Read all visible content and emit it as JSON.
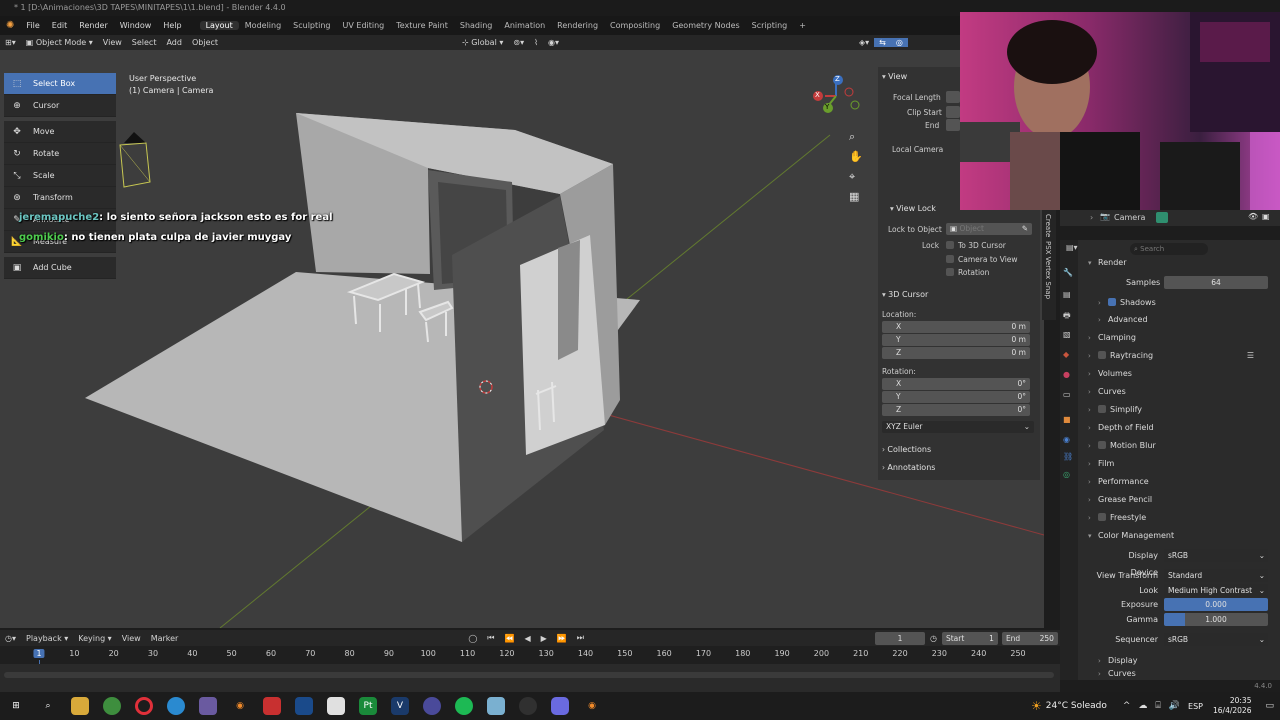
{
  "window": {
    "title": "* 1 [D:\\Animaciones\\3D TAPES\\MINITAPES\\1\\1.blend] - Blender 4.4.0"
  },
  "menubar": {
    "menus": [
      "File",
      "Edit",
      "Render",
      "Window",
      "Help"
    ],
    "workspaces": [
      "Layout",
      "Modeling",
      "Sculpting",
      "UV Editing",
      "Texture Paint",
      "Shading",
      "Animation",
      "Rendering",
      "Compositing",
      "Geometry Nodes",
      "Scripting"
    ],
    "active_workspace": "Layout",
    "add_tab": "+"
  },
  "viewport_header": {
    "mode": "Object Mode",
    "menus": [
      "View",
      "Select",
      "Add",
      "Object"
    ],
    "orientation": "Global"
  },
  "toolbar": {
    "tools": [
      "Select Box",
      "Cursor",
      "Move",
      "Rotate",
      "Scale",
      "Transform",
      "Annotate",
      "Measure",
      "Add Cube"
    ],
    "active": "Select Box"
  },
  "overlay": {
    "line1": "User Perspective",
    "line2": "(1) Camera | Camera"
  },
  "chat": [
    {
      "user": "jeremapuche2",
      "message": "lo siento señora jackson esto es for real"
    },
    {
      "user": "gomikio",
      "message": "no tienen plata culpa de javier muygay"
    }
  ],
  "gizmo": {
    "x": "X",
    "y": "Y",
    "z": "Z"
  },
  "npanel": {
    "view_section": "View",
    "focal_length": "Focal Length",
    "clip_start": "Clip Start",
    "clip_end": "End",
    "local_camera": "Local Camera",
    "view_lock_section": "View Lock",
    "lock_to_object": "Lock to Object",
    "object_placeholder": "Object",
    "lock_label": "Lock",
    "lock_options": [
      "To 3D Cursor",
      "Camera to View",
      "Rotation"
    ],
    "cursor_section": "3D Cursor",
    "location_label": "Location:",
    "location": [
      {
        "axis": "X",
        "value": "0 m"
      },
      {
        "axis": "Y",
        "value": "0 m"
      },
      {
        "axis": "Z",
        "value": "0 m"
      }
    ],
    "rotation_label": "Rotation:",
    "rotation": [
      {
        "axis": "X",
        "value": "0°"
      },
      {
        "axis": "Y",
        "value": "0°"
      },
      {
        "axis": "Z",
        "value": "0°"
      }
    ],
    "rotation_mode": "XYZ Euler",
    "collections": "Collections",
    "annotations": "Annotations"
  },
  "side_tabs": [
    "Create",
    "PSX Vertex Snap"
  ],
  "outliner": {
    "camera_label": "Camera"
  },
  "properties": {
    "search_placeholder": "Search",
    "render_section": "Render",
    "samples_label": "Samples",
    "samples_value": "64",
    "shadows": "Shadows",
    "advanced": "Advanced",
    "sections": [
      "Clamping",
      "Raytracing",
      "Volumes",
      "Curves",
      "Simplify",
      "Depth of Field",
      "Motion Blur",
      "Film",
      "Performance",
      "Grease Pencil",
      "Freestyle"
    ],
    "color_management": "Color Management",
    "display_device_label": "Display Device",
    "display_device": "sRGB",
    "view_transform_label": "View Transform",
    "view_transform": "Standard",
    "look_label": "Look",
    "look": "Medium High Contrast",
    "exposure_label": "Exposure",
    "exposure": "0.000",
    "gamma_label": "Gamma",
    "gamma": "1.000",
    "sequencer_label": "Sequencer",
    "sequencer": "sRGB",
    "display": "Display",
    "curves_sub": "Curves"
  },
  "timeline": {
    "menus": [
      "Playback",
      "Keying",
      "View",
      "Marker"
    ],
    "current_frame": "1",
    "start_label": "Start",
    "start": "1",
    "end_label": "End",
    "end": "250",
    "ruler": [
      "1",
      "10",
      "20",
      "30",
      "40",
      "50",
      "60",
      "70",
      "80",
      "90",
      "100",
      "110",
      "120",
      "130",
      "140",
      "150",
      "160",
      "170",
      "180",
      "190",
      "200",
      "210",
      "220",
      "230",
      "240",
      "250"
    ]
  },
  "version": "4.4.0",
  "taskbar": {
    "weather": "24°C  Soleado",
    "lang": "ESP",
    "time": "20:35",
    "date": "16/4/2026"
  },
  "colors": {
    "accent": "#4772b3",
    "viewport": "#3d3d3d",
    "x_axis": "#c73636",
    "y_axis": "#6a9e2c"
  }
}
